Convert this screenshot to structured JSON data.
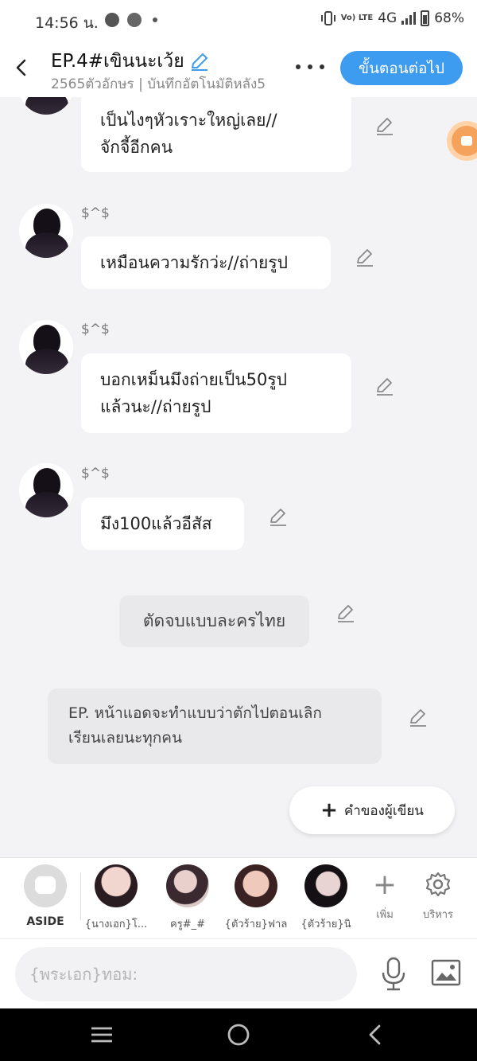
{
  "status_bar": {
    "time": "14:56 น.",
    "network": "4G",
    "volte": "Vo) LTE",
    "battery": "68%"
  },
  "header": {
    "title": "EP.4#เขินนะเว้ย",
    "subtitle": "2565ตัวอักษร | บันทึกอัตโนมัติหลัง5",
    "next_label": "ขั้นตอนต่อไป"
  },
  "messages": [
    {
      "name": "",
      "lines": [
        "เป็นไงๆหัวเราะใหญ่เลย//",
        "จักจี้อีกคน"
      ]
    },
    {
      "name": "$^$",
      "lines": [
        "เหมือนความรักว่ะ//ถ่ายรูป"
      ]
    },
    {
      "name": "$^$",
      "lines": [
        "บอกเหม็นมึงถ่ายเป็น50รูป",
        "แล้วนะ//ถ่ายรูป"
      ]
    },
    {
      "name": "$^$",
      "lines": [
        "มึง100แล้วอีสัส"
      ]
    }
  ],
  "narration": {
    "lines": [
      "ตัดจบแบบละครไทย"
    ]
  },
  "author_note": {
    "lines": [
      "EP. หน้าแอดจะทำแบบว่าตักไปตอนเลิก",
      "เรียนเลยนะทุกคน"
    ]
  },
  "author_note_button": "คำของผู้เขียน",
  "characters": {
    "aside_label": "ASIDE",
    "items": [
      {
        "label": "{นางเอก}โ..."
      },
      {
        "label": "ครู#_#"
      },
      {
        "label": "{ตัวร้าย}ฟาล"
      },
      {
        "label": "{ตัวร้าย}นิ"
      }
    ],
    "add_label": "เพิ่ม",
    "manage_label": "บริหาร"
  },
  "input": {
    "placeholder": "{พระเอก}ทอม:"
  },
  "colors": {
    "accent": "#3d9bf0",
    "record": "#f5a35c"
  }
}
